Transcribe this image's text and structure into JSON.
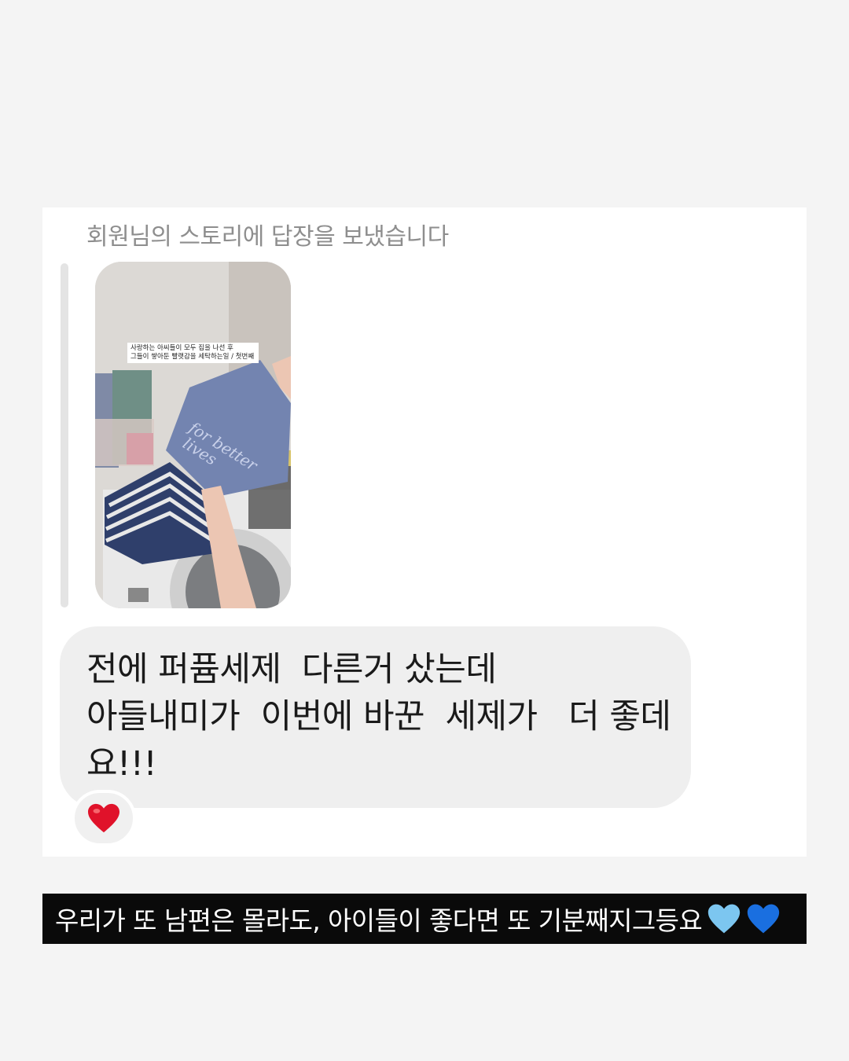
{
  "header": {
    "title": "회원님의 스토리에 답장을 보냈습니다"
  },
  "story": {
    "caption": "사랑하는 아씨들이 모두 집을 나선 후\n그들이 쌓아둔 빨랫감을 세탁하는일 / 첫번째",
    "product_text": "for better lives"
  },
  "message": {
    "text": "전에 퍼퓸세제  다른거 샀는데\n아들내미가  이번에 바꾼  세제가   더 좋데\n요!!!"
  },
  "reaction": {
    "icon": "red-heart-icon",
    "color": "#e0122a"
  },
  "caption": {
    "text": "우리가 또 남편은 몰라도, 아이들이 좋다면 또 기분째지그등요",
    "hearts": [
      "light-blue-heart-icon",
      "blue-heart-icon"
    ],
    "heart_colors": [
      "#7cc6f0",
      "#1a6fe0"
    ]
  }
}
